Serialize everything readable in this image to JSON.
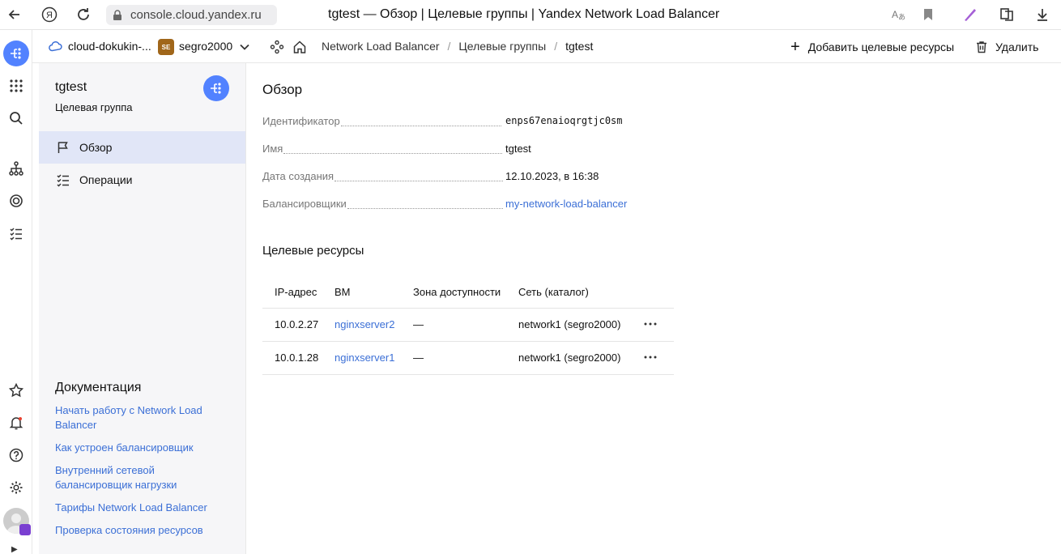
{
  "browser": {
    "url": "console.cloud.yandex.ru",
    "title": "tgtest — Обзор | Целевые группы | Yandex Network Load Balancer"
  },
  "context": {
    "cloud": "cloud-dokukin-...",
    "folder_badge": "SE",
    "folder": "segro2000"
  },
  "breadcrumbs": [
    "Network Load Balancer",
    "Целевые группы",
    "tgtest"
  ],
  "actions": {
    "add": "Добавить целевые ресурсы",
    "delete": "Удалить"
  },
  "sidebar": {
    "title": "tgtest",
    "subtitle": "Целевая группа",
    "items": [
      {
        "label": "Обзор",
        "icon": "flag-icon",
        "active": true
      },
      {
        "label": "Операции",
        "icon": "checklist-icon",
        "active": false
      }
    ],
    "docs_title": "Документация",
    "docs": [
      "Начать работу с Network Load Balancer",
      "Как устроен балансировщик",
      "Внутренний сетевой балансировщик нагрузки",
      "Тарифы Network Load Balancer",
      "Проверка состояния ресурсов"
    ]
  },
  "overview": {
    "heading": "Обзор",
    "props": [
      {
        "key": "Идентификатор",
        "value": "enps67enaioqrgtjc0sm"
      },
      {
        "key": "Имя",
        "value": "tgtest"
      },
      {
        "key": "Дата создания",
        "value": "12.10.2023, в 16:38"
      },
      {
        "key": "Балансировщики",
        "value": "my-network-load-balancer"
      }
    ]
  },
  "targets": {
    "heading": "Целевые ресурсы",
    "columns": [
      "IP-адрес",
      "ВМ",
      "Зона доступности",
      "Сеть (каталог)"
    ],
    "rows": [
      {
        "ip": "10.0.2.27",
        "vm": "nginxserver2",
        "zone": "—",
        "network": "network1 (segro2000)"
      },
      {
        "ip": "10.0.1.28",
        "vm": "nginxserver1",
        "zone": "—",
        "network": "network1 (segro2000)"
      }
    ]
  },
  "colors": {
    "accent": "#5282ff",
    "link": "#3b6fd6",
    "folder_badge": "#a0661a"
  }
}
